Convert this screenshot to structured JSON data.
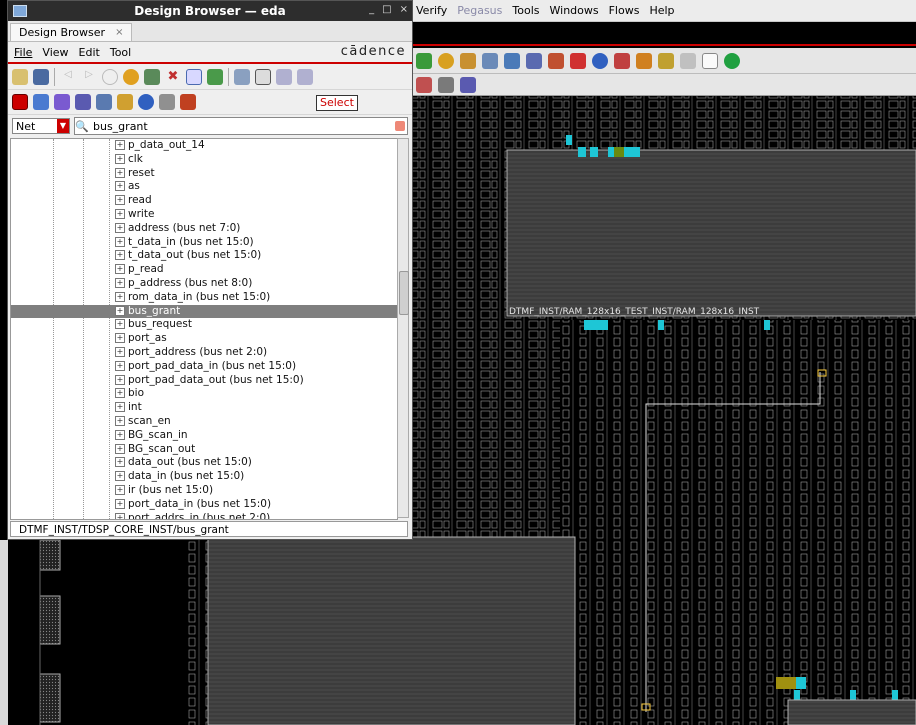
{
  "design_browser": {
    "title": "Design Browser — eda",
    "tab_label": "Design Browser",
    "tab_close": "×",
    "window_controls": [
      "_",
      "□",
      "×"
    ],
    "menu": [
      "File",
      "View",
      "Edit",
      "Tool"
    ],
    "logo": "cādence",
    "tooltip": "Select",
    "filter_type": "Net",
    "search_value": "bus_grant",
    "tree_items": [
      "p_data_out_14",
      "clk",
      "reset",
      "as",
      "read",
      "write",
      "address (bus net 7:0)",
      "t_data_in (bus net 15:0)",
      "t_data_out (bus net 15:0)",
      "p_read",
      "p_address (bus net 8:0)",
      "rom_data_in (bus net 15:0)",
      "bus_grant",
      "bus_request",
      "port_as",
      "port_address (bus net 2:0)",
      "port_pad_data_in (bus net 15:0)",
      "port_pad_data_out (bus net 15:0)",
      "bio",
      "int",
      "scan_en",
      "BG_scan_in",
      "BG_scan_out",
      "data_out (bus net 15:0)",
      "data_in (bus net 15:0)",
      "ir (bus net 15:0)",
      "port_data_in (bus net 15:0)",
      "port_addrs_in (bus net 2:0)"
    ],
    "selected_index": 12,
    "status_path": "DTMF_INST/TDSP_CORE_INST/bus_grant"
  },
  "main_window": {
    "menu": [
      "Verify",
      "Pegasus",
      "Tools",
      "Windows",
      "Flows",
      "Help"
    ],
    "menu_disabled": [
      "Pegasus"
    ]
  },
  "layout_view": {
    "instance_label": "DTMF_INST/RAM_128x16_TEST_INST/RAM_128x16_INST"
  },
  "colors": {
    "accent_red": "#cc0000",
    "selection_gray": "#7f7f7f",
    "highlight_cyan": "#1ec6d6"
  }
}
